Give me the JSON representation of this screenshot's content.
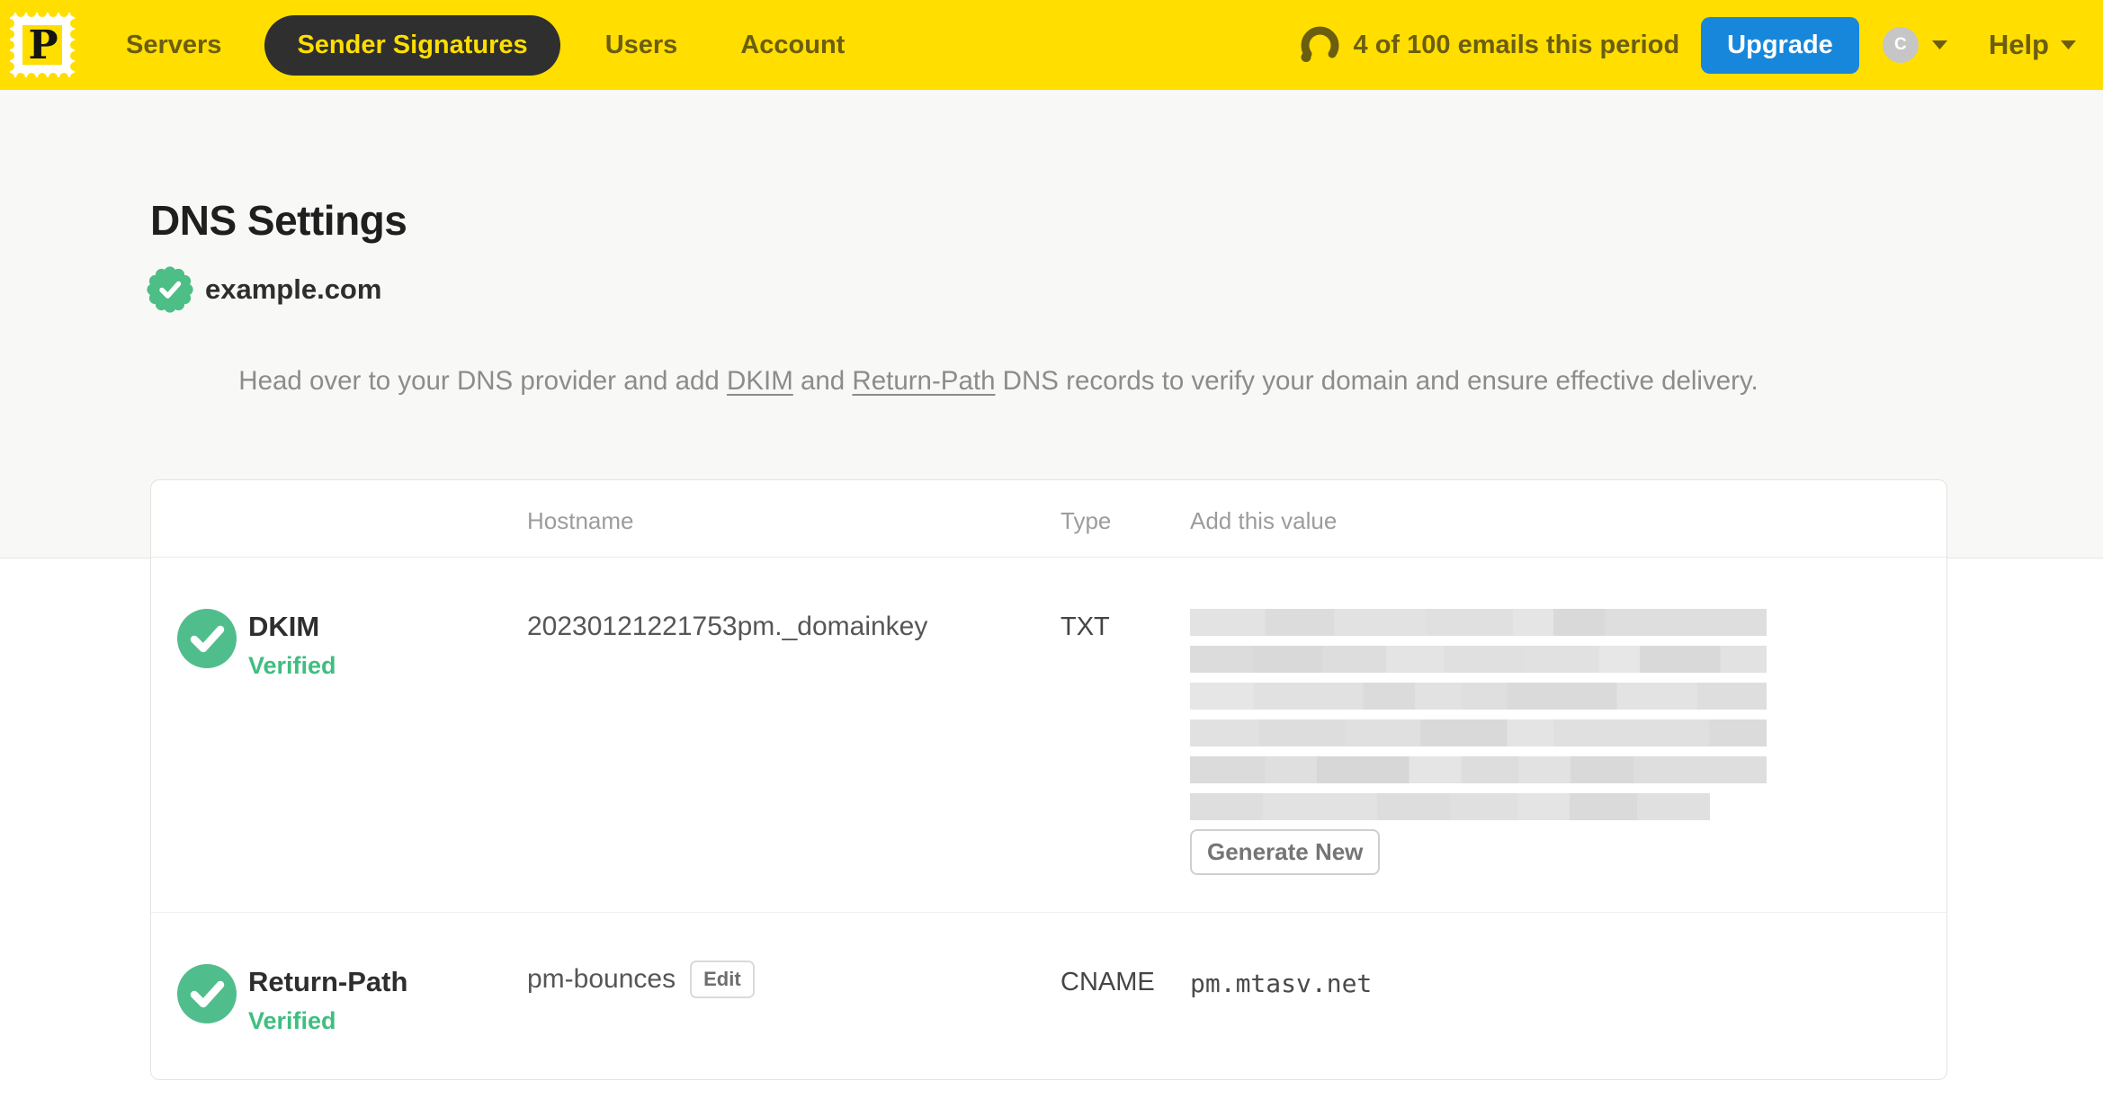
{
  "nav": {
    "logo_letter": "P",
    "items": [
      {
        "label": "Servers",
        "active": false
      },
      {
        "label": "Sender Signatures",
        "active": true
      },
      {
        "label": "Users",
        "active": false
      },
      {
        "label": "Account",
        "active": false
      }
    ],
    "usage_text": "4 of 100 emails this period",
    "upgrade_label": "Upgrade",
    "avatar_initial": "C",
    "help_label": "Help"
  },
  "page": {
    "title": "DNS Settings",
    "domain": "example.com",
    "intro": {
      "part1": "Head over to your DNS provider and add ",
      "link_dkim": "DKIM",
      "part2": " and ",
      "link_return_path": "Return-Path",
      "part3": " DNS records to verify your domain and ensure effective delivery."
    }
  },
  "table": {
    "headers": {
      "hostname": "Hostname",
      "type": "Type",
      "value": "Add this value"
    },
    "rows": [
      {
        "name": "DKIM",
        "status": "Verified",
        "hostname": "20230121221753pm._domainkey",
        "type": "TXT",
        "value_redacted": true,
        "action_label": "Generate New"
      },
      {
        "name": "Return-Path",
        "status": "Verified",
        "hostname": "pm-bounces",
        "edit_label": "Edit",
        "type": "CNAME",
        "value": "pm.mtasv.net"
      }
    ]
  },
  "colors": {
    "brand_yellow": "#FFDE00",
    "nav_text_olive": "#6B5E10",
    "active_pill_bg": "#2F2F2F",
    "upgrade_blue": "#1787DB",
    "success_green": "#4FBE8B",
    "text_dark": "#2E2E2E",
    "text_gray": "#8C8C8C"
  }
}
